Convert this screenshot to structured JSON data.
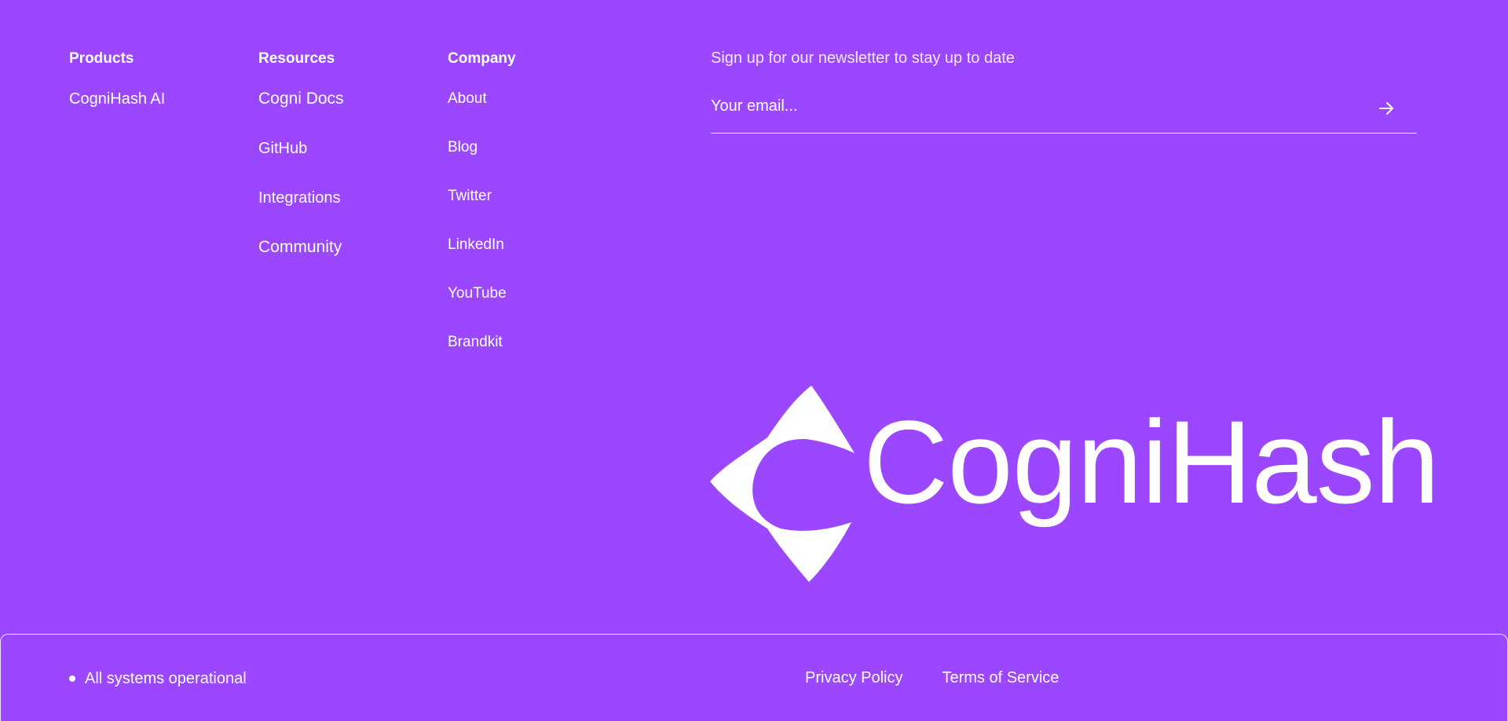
{
  "footer": {
    "columns": [
      {
        "title": "Products",
        "links": [
          "CogniHash AI"
        ]
      },
      {
        "title": "Resources",
        "links": [
          "Cogni Docs",
          "GitHub",
          "Integrations",
          "Community"
        ]
      },
      {
        "title": "Company",
        "links": [
          "About",
          "Blog",
          "Twitter",
          "LinkedIn",
          "YouTube",
          "Brandkit"
        ]
      }
    ]
  },
  "newsletter": {
    "label": "Sign up for our newsletter to stay up to date",
    "email_placeholder": "Your email...",
    "submit_icon": "arrow-right-icon"
  },
  "brand": {
    "name": "CogniHash",
    "logo_icon": "cognihash-mark-icon"
  },
  "bottom_bar": {
    "status_text": "All systems operational",
    "privacy_label": "Privacy Policy",
    "terms_label": "Terms of Service"
  },
  "colors": {
    "background": "#9a47ff",
    "foreground": "#ffffff"
  }
}
